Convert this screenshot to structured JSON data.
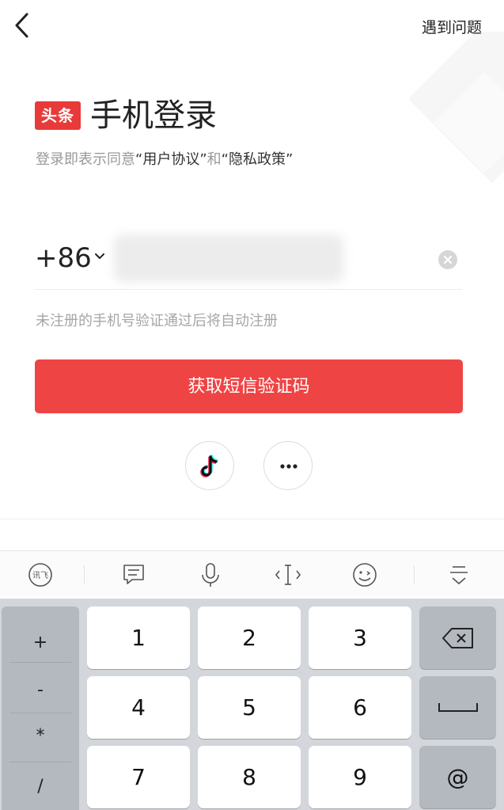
{
  "header": {
    "back_icon": "chevron-left-icon",
    "help_label": "遇到问题"
  },
  "login": {
    "logo_text": "头条",
    "title": "手机登录",
    "agreement": {
      "prefix": "登录即表示同意",
      "user_agreement": "“用户协议”",
      "and": "和",
      "privacy_policy": "“隐私政策”"
    },
    "country_code": "+86",
    "phone_placeholder": "",
    "hint": "未注册的手机号验证通过后将自动注册",
    "sms_button_label": "获取短信验证码",
    "alt_logins": [
      {
        "icon": "tiktok-icon"
      },
      {
        "icon": "more-icon"
      }
    ],
    "accent_color": "#EF4444"
  },
  "keyboard": {
    "toolbar_icons": [
      "handwriting-icon",
      "message-icon",
      "microphone-icon",
      "cursor-icon",
      "emoji-icon",
      "hide-keyboard-icon"
    ],
    "symbols": [
      "+",
      "-",
      "*",
      "/"
    ],
    "digits": [
      [
        "1",
        "2",
        "3"
      ],
      [
        "4",
        "5",
        "6"
      ],
      [
        "7",
        "8",
        "9"
      ]
    ],
    "right_keys": {
      "backspace_icon": "backspace-icon",
      "space_icon": "space-icon",
      "at": "@"
    }
  }
}
